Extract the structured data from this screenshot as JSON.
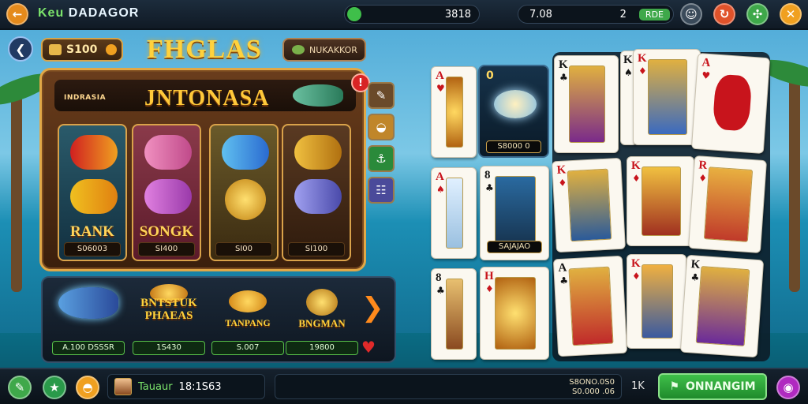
{
  "colors": {
    "accent_gold": "#ffd23c",
    "green": "#3fbf4a",
    "red": "#d82424",
    "card_red": "#c8141c"
  },
  "topbar": {
    "app_title_a": "Keu",
    "app_title_b": "DADAGOR",
    "balance_value": "3818",
    "stat_value_a": "7.08",
    "stat_value_b": "2",
    "stat_button_label": "RDE",
    "icons": [
      "back-arrow-icon",
      "coin-icon",
      "smile-icon",
      "refresh-icon",
      "puzzle-icon",
      "close-icon"
    ]
  },
  "header": {
    "coin_amount": "S100",
    "logo_title": "FHGLAS",
    "brand_label": "NUKAKKOR"
  },
  "slot": {
    "sub_label": "INDRASIA",
    "name": "JNTONASA",
    "alert_label": "!",
    "reels": [
      {
        "label": "RANK",
        "value": "S06003"
      },
      {
        "label": "SONGK",
        "value": "SI400"
      },
      {
        "label": "",
        "value": "SI00"
      },
      {
        "label": "",
        "value": "SI100"
      }
    ],
    "side_buttons": [
      "brush-icon",
      "shell-icon",
      "hook-icon",
      "robot-icon"
    ]
  },
  "bonus": {
    "items": [
      {
        "name": "",
        "value": "A.100 DSSSR"
      },
      {
        "name": "BNTSTUK PHAEAS",
        "value": "1S430"
      },
      {
        "name": "TANPANG",
        "value": "S.007"
      },
      {
        "name": "BNGMAN",
        "value": "19800"
      }
    ],
    "heart_label": "heart-icon"
  },
  "cards": {
    "column_a": [
      {
        "rank": "A",
        "suit": "♥",
        "color": "red"
      },
      {
        "rank": "A",
        "suit": "♠",
        "color": "red"
      },
      {
        "rank": "8",
        "suit": "♣",
        "color": "black"
      }
    ],
    "dark_cards": [
      {
        "value": "S8000 0"
      },
      {
        "value": "SAJAJAO"
      }
    ],
    "column_b_bottom": {
      "rank": "H",
      "suit": "♦",
      "color": "red"
    },
    "card_b_middle": {
      "rank": "8",
      "suit": "♣",
      "color": "black"
    },
    "grid": [
      {
        "rank": "K",
        "suit": "♣",
        "color": "black"
      },
      {
        "rank": "K",
        "suit": "♠",
        "color": "black"
      },
      {
        "rank": "K",
        "suit": "♦",
        "color": "red"
      },
      {
        "rank": "A",
        "suit": "♥",
        "color": "red"
      },
      {
        "rank": "K",
        "suit": "♦",
        "color": "red"
      },
      {
        "rank": "K",
        "suit": "♦",
        "color": "red"
      },
      {
        "rank": "R",
        "suit": "♦",
        "color": "red"
      },
      {
        "rank": "A",
        "suit": "♣",
        "color": "black"
      },
      {
        "rank": "K",
        "suit": "♦",
        "color": "red"
      },
      {
        "rank": "K",
        "suit": "♣",
        "color": "black"
      }
    ]
  },
  "bottombar": {
    "player_name": "Tauaur",
    "player_score": "18:1S63",
    "wallet_line_a": "S8ONO.0S0",
    "wallet_line_b": "S0.000 .06",
    "wallet_short": "1K",
    "action_label": "ONNANGIM"
  }
}
